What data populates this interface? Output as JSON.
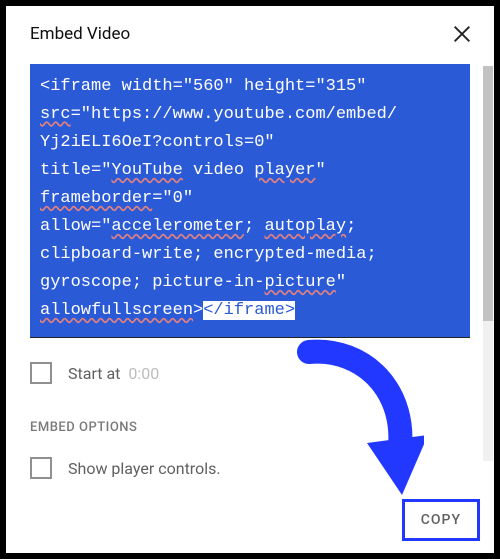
{
  "header": {
    "title": "Embed Video"
  },
  "code": {
    "l1": "<iframe width=\"560\" height=\"315\"",
    "sq1": "src",
    "l2": "=\"https://www.youtube.com/embed/",
    "l3": "Yj2iELI6OeI?controls=0\"",
    "l4a": "title=\"",
    "sq2": "YouTube",
    "l4b": " video ",
    "sq3": "player",
    "l4c": "\"",
    "sq4": "frameborder",
    "l5": "=\"0\"",
    "l6a": "allow=\"",
    "sq5": "accelerometer",
    "l6b": "; ",
    "sq6": "autoplay",
    "l6c": ";",
    "l7a": "clipboard-write; encrypted-media;",
    "l8a": "gyroscope; picture-in-",
    "sq7": "picture",
    "l8b": "\"",
    "sq8": "allowfullscreen",
    "l9a": ">",
    "l9b": "</iframe>"
  },
  "start_at": {
    "label": "Start at",
    "time": "0:00"
  },
  "embed_options": {
    "title": "EMBED OPTIONS",
    "show_controls": "Show player controls."
  },
  "footer": {
    "copy_label": "COPY"
  }
}
